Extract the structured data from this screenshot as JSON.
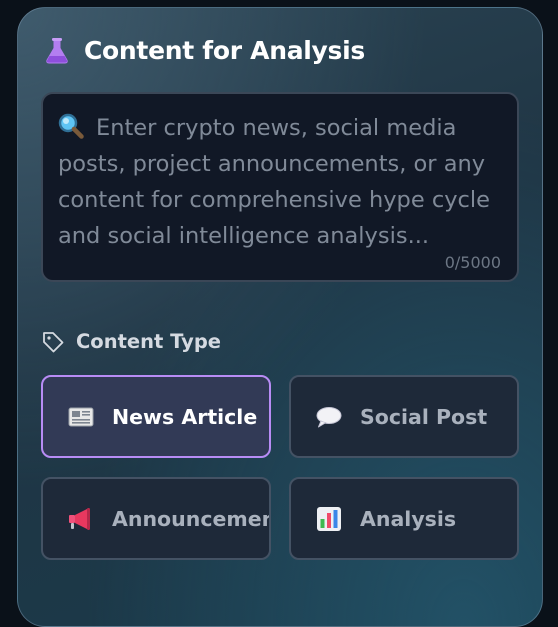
{
  "panel": {
    "title": "Content for Analysis",
    "title_icon": "flask-icon"
  },
  "content_input": {
    "icon": "magnifier-icon",
    "placeholder": "Enter crypto news, social media posts, project announcements, or any content for comprehensive hype cycle and social intelligence analysis...",
    "value": "",
    "counter": "0/5000"
  },
  "content_type": {
    "label": "Content Type",
    "icon": "tag-icon",
    "selected": "News Article",
    "options": [
      {
        "label": "News Article",
        "icon": "newspaper-icon",
        "selected": true
      },
      {
        "label": "Social Post",
        "icon": "speech-bubble-icon",
        "selected": false
      },
      {
        "label": "Announcement",
        "icon": "megaphone-icon",
        "selected": false
      },
      {
        "label": "Analysis",
        "icon": "bar-chart-icon",
        "selected": false
      }
    ]
  },
  "colors": {
    "accent": "#b88cf5",
    "panel_bg": "#233c4b",
    "input_bg": "#111826"
  }
}
